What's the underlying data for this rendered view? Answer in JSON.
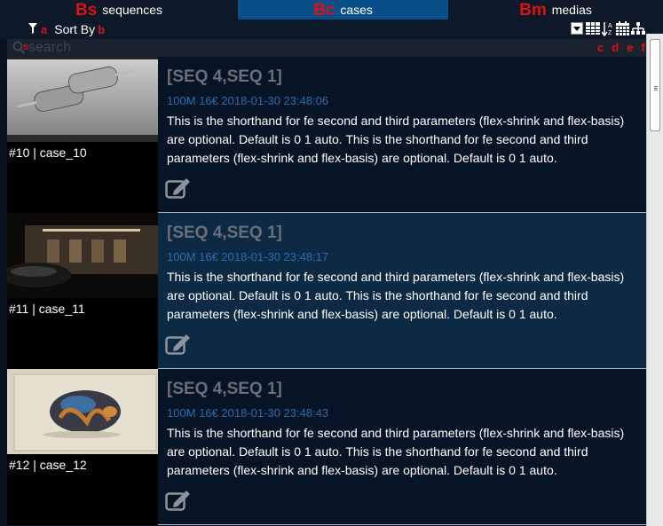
{
  "tabs": [
    {
      "marker": "Bs",
      "label": "sequences",
      "active": false
    },
    {
      "marker": "Bc",
      "label": "cases",
      "active": true
    },
    {
      "marker": "Bm",
      "label": "medias",
      "active": false
    }
  ],
  "toolbar": {
    "marker_a": "a",
    "sort_label": "Sort By",
    "marker_b": "b",
    "view_markers": [
      "c",
      "d",
      "e",
      "f"
    ]
  },
  "search": {
    "marker": "s",
    "placeholder": "search"
  },
  "cases": [
    {
      "id_label": "#10 | case_10",
      "title": "[SEQ 4,SEQ 1]",
      "meta": "100M 16€ 2018-01-30 23:48:06",
      "description": "This is the shorthand for fe second and third parameters (flex-shrink and flex-basis) are optional. Default is 0 1 auto. This is the shorthand for fe second and third parameters (flex-shrink and flex-basis) are optional. Default is 0 1 auto."
    },
    {
      "id_label": "#11 | case_11",
      "title": "[SEQ 4,SEQ 1]",
      "meta": "100M 16€ 2018-01-30 23:48:17",
      "description": "This is the shorthand for fe second and third parameters (flex-shrink and flex-basis) are optional. Default is 0 1 auto. This is the shorthand for fe second and third parameters (flex-shrink and flex-basis) are optional. Default is 0 1 auto."
    },
    {
      "id_label": "#12 | case_12",
      "title": "[SEQ 4,SEQ 1]",
      "meta": "100M 16€ 2018-01-30 23:48:43",
      "description": "This is the shorthand for fe second and third parameters (flex-shrink and flex-basis) are optional. Default is 0 1 auto. This is the shorthand for fe second and third parameters (flex-shrink and flex-basis) are optional. Default is 0 1 auto."
    }
  ],
  "colors": {
    "marker_red": "#e01010",
    "active_tab": "#0a4f8a",
    "row_dark": "#071426",
    "row_highlight": "#0d2a44",
    "title_gray": "#6a6f76",
    "meta_blue": "#2b6cb0"
  },
  "icons": [
    "filter-icon",
    "search-icon",
    "grid-view-icon",
    "sort-az-icon",
    "calendar-icon",
    "hierarchy-icon",
    "edit-icon",
    "dropdown-icon"
  ]
}
